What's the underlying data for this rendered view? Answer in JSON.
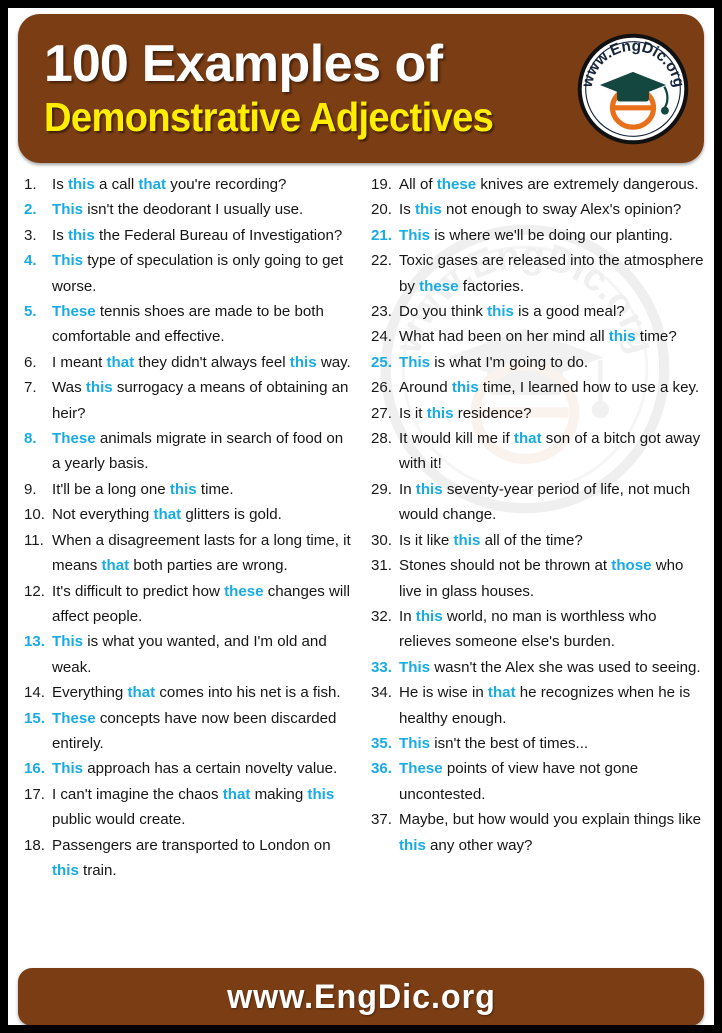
{
  "header": {
    "title_number": "100",
    "title_rest": "Examples of",
    "subtitle": "Demonstrative Adjectives",
    "logo_text": "www.EngDic.org",
    "brand_brown": "#7B3D14",
    "accent_yellow": "#FFEE00",
    "accent_cyan": "#18ABE4",
    "logo_cap_color": "#14473F",
    "logo_e_color": "#E8701A"
  },
  "footer": {
    "url": "www.EngDic.org"
  },
  "watermark": {
    "text": "www.EngDic.org"
  },
  "columns": {
    "left": [
      {
        "n": "1.",
        "hl": false,
        "parts": [
          [
            "Is ",
            0
          ],
          [
            "this",
            1
          ],
          [
            " a call ",
            0
          ],
          [
            "that",
            1
          ],
          [
            " you're recording?",
            0
          ]
        ]
      },
      {
        "n": "2.",
        "hl": true,
        "parts": [
          [
            "This",
            1
          ],
          [
            " isn't the deodorant I usually use.",
            0
          ]
        ]
      },
      {
        "n": "3.",
        "hl": false,
        "parts": [
          [
            "Is ",
            0
          ],
          [
            "this",
            1
          ],
          [
            " the Federal Bureau of Investigation?",
            0
          ]
        ]
      },
      {
        "n": "4.",
        "hl": true,
        "parts": [
          [
            "This",
            1
          ],
          [
            " type of speculation is only going to get worse.",
            0
          ]
        ]
      },
      {
        "n": "5.",
        "hl": true,
        "parts": [
          [
            "These",
            1
          ],
          [
            " tennis shoes are made to be both comfortable and effective.",
            0
          ]
        ]
      },
      {
        "n": "6.",
        "hl": false,
        "parts": [
          [
            "I meant ",
            0
          ],
          [
            "that",
            1
          ],
          [
            " they didn't always feel ",
            0
          ],
          [
            "this",
            1
          ],
          [
            " way.",
            0
          ]
        ]
      },
      {
        "n": "7.",
        "hl": false,
        "parts": [
          [
            "Was ",
            0
          ],
          [
            "this",
            1
          ],
          [
            " surrogacy a means of obtaining an heir?",
            0
          ]
        ]
      },
      {
        "n": "8.",
        "hl": true,
        "parts": [
          [
            "These",
            1
          ],
          [
            " animals migrate in search of food on a yearly basis.",
            0
          ]
        ]
      },
      {
        "n": "9.",
        "hl": false,
        "parts": [
          [
            "It'll be a long one ",
            0
          ],
          [
            "this",
            1
          ],
          [
            " time.",
            0
          ]
        ]
      },
      {
        "n": "10.",
        "hl": false,
        "parts": [
          [
            "Not everything ",
            0
          ],
          [
            "that",
            1
          ],
          [
            " glitters is gold.",
            0
          ]
        ]
      },
      {
        "n": "11.",
        "hl": false,
        "parts": [
          [
            "When a disagreement lasts for a long time, it means ",
            0
          ],
          [
            "that",
            1
          ],
          [
            " both parties are wrong.",
            0
          ]
        ]
      },
      {
        "n": "12.",
        "hl": false,
        "parts": [
          [
            "It's difficult to predict how ",
            0
          ],
          [
            "these",
            1
          ],
          [
            " changes will affect people.",
            0
          ]
        ]
      },
      {
        "n": "13.",
        "hl": true,
        "parts": [
          [
            "This",
            1
          ],
          [
            " is what you wanted, and I'm old and weak.",
            0
          ]
        ]
      },
      {
        "n": "14.",
        "hl": false,
        "parts": [
          [
            "Everything ",
            0
          ],
          [
            "that",
            1
          ],
          [
            " comes into his net is a fish.",
            0
          ]
        ]
      },
      {
        "n": "15.",
        "hl": true,
        "parts": [
          [
            "These",
            1
          ],
          [
            " concepts have now been discarded entirely.",
            0
          ]
        ]
      },
      {
        "n": "16.",
        "hl": true,
        "parts": [
          [
            "This",
            1
          ],
          [
            " approach has a certain novelty value.",
            0
          ]
        ]
      },
      {
        "n": "17.",
        "hl": false,
        "parts": [
          [
            "I can't imagine the chaos ",
            0
          ],
          [
            "that",
            1
          ],
          [
            " making ",
            0
          ],
          [
            "this",
            1
          ],
          [
            " public would create.",
            0
          ]
        ]
      },
      {
        "n": "18.",
        "hl": false,
        "parts": [
          [
            "Passengers are transported to London on ",
            0
          ],
          [
            "this",
            1
          ],
          [
            " train.",
            0
          ]
        ]
      }
    ],
    "right": [
      {
        "n": "19.",
        "hl": false,
        "parts": [
          [
            "All of ",
            0
          ],
          [
            "these",
            1
          ],
          [
            " knives are extremely dangerous.",
            0
          ]
        ]
      },
      {
        "n": "20.",
        "hl": false,
        "parts": [
          [
            "Is ",
            0
          ],
          [
            "this",
            1
          ],
          [
            " not enough to sway Alex's opinion?",
            0
          ]
        ]
      },
      {
        "n": "21.",
        "hl": true,
        "parts": [
          [
            "This",
            1
          ],
          [
            " is where we'll be doing our planting.",
            0
          ]
        ]
      },
      {
        "n": "22.",
        "hl": false,
        "parts": [
          [
            "Toxic gases are released into the atmosphere by ",
            0
          ],
          [
            "these",
            1
          ],
          [
            " factories.",
            0
          ]
        ]
      },
      {
        "n": "23.",
        "hl": false,
        "parts": [
          [
            "Do you think ",
            0
          ],
          [
            "this",
            1
          ],
          [
            " is a good meal?",
            0
          ]
        ]
      },
      {
        "n": "24.",
        "hl": false,
        "parts": [
          [
            "What had been on her mind all ",
            0
          ],
          [
            "this",
            1
          ],
          [
            " time?",
            0
          ]
        ]
      },
      {
        "n": "25.",
        "hl": true,
        "parts": [
          [
            "This",
            1
          ],
          [
            " is what I'm going to do.",
            0
          ]
        ]
      },
      {
        "n": "26.",
        "hl": false,
        "parts": [
          [
            "Around ",
            0
          ],
          [
            "this",
            1
          ],
          [
            " time, I learned how to use a key.",
            0
          ]
        ]
      },
      {
        "n": "27.",
        "hl": false,
        "parts": [
          [
            "Is it ",
            0
          ],
          [
            "this",
            1
          ],
          [
            " residence?",
            0
          ]
        ]
      },
      {
        "n": "28.",
        "hl": false,
        "parts": [
          [
            "It would kill me if ",
            0
          ],
          [
            "that",
            1
          ],
          [
            " son of a bitch got away with it!",
            0
          ]
        ]
      },
      {
        "n": "29.",
        "hl": false,
        "parts": [
          [
            "In ",
            0
          ],
          [
            "this",
            1
          ],
          [
            " seventy-year period of life, not much would change.",
            0
          ]
        ]
      },
      {
        "n": "30.",
        "hl": false,
        "parts": [
          [
            "Is it like ",
            0
          ],
          [
            "this",
            1
          ],
          [
            " all of the time?",
            0
          ]
        ]
      },
      {
        "n": "31.",
        "hl": false,
        "parts": [
          [
            "Stones should not be thrown at ",
            0
          ],
          [
            "those",
            1
          ],
          [
            " who live in glass houses.",
            0
          ]
        ]
      },
      {
        "n": "32.",
        "hl": false,
        "parts": [
          [
            "In ",
            0
          ],
          [
            "this",
            1
          ],
          [
            " world, no man is worthless who relieves someone else's burden.",
            0
          ]
        ]
      },
      {
        "n": "33.",
        "hl": true,
        "parts": [
          [
            "This",
            1
          ],
          [
            " wasn't the Alex she was used to seeing.",
            0
          ]
        ]
      },
      {
        "n": "34.",
        "hl": false,
        "parts": [
          [
            "He is wise in ",
            0
          ],
          [
            "that",
            1
          ],
          [
            " he recognizes when he is healthy enough.",
            0
          ]
        ]
      },
      {
        "n": "35.",
        "hl": true,
        "parts": [
          [
            "This",
            1
          ],
          [
            " isn't the best of times...",
            0
          ]
        ]
      },
      {
        "n": "36.",
        "hl": true,
        "parts": [
          [
            "These",
            1
          ],
          [
            " points of view have not gone uncontested.",
            0
          ]
        ]
      },
      {
        "n": "37.",
        "hl": false,
        "parts": [
          [
            "Maybe, but how would you explain things like ",
            0
          ],
          [
            "this",
            1
          ],
          [
            " any other way?",
            0
          ]
        ]
      }
    ]
  }
}
